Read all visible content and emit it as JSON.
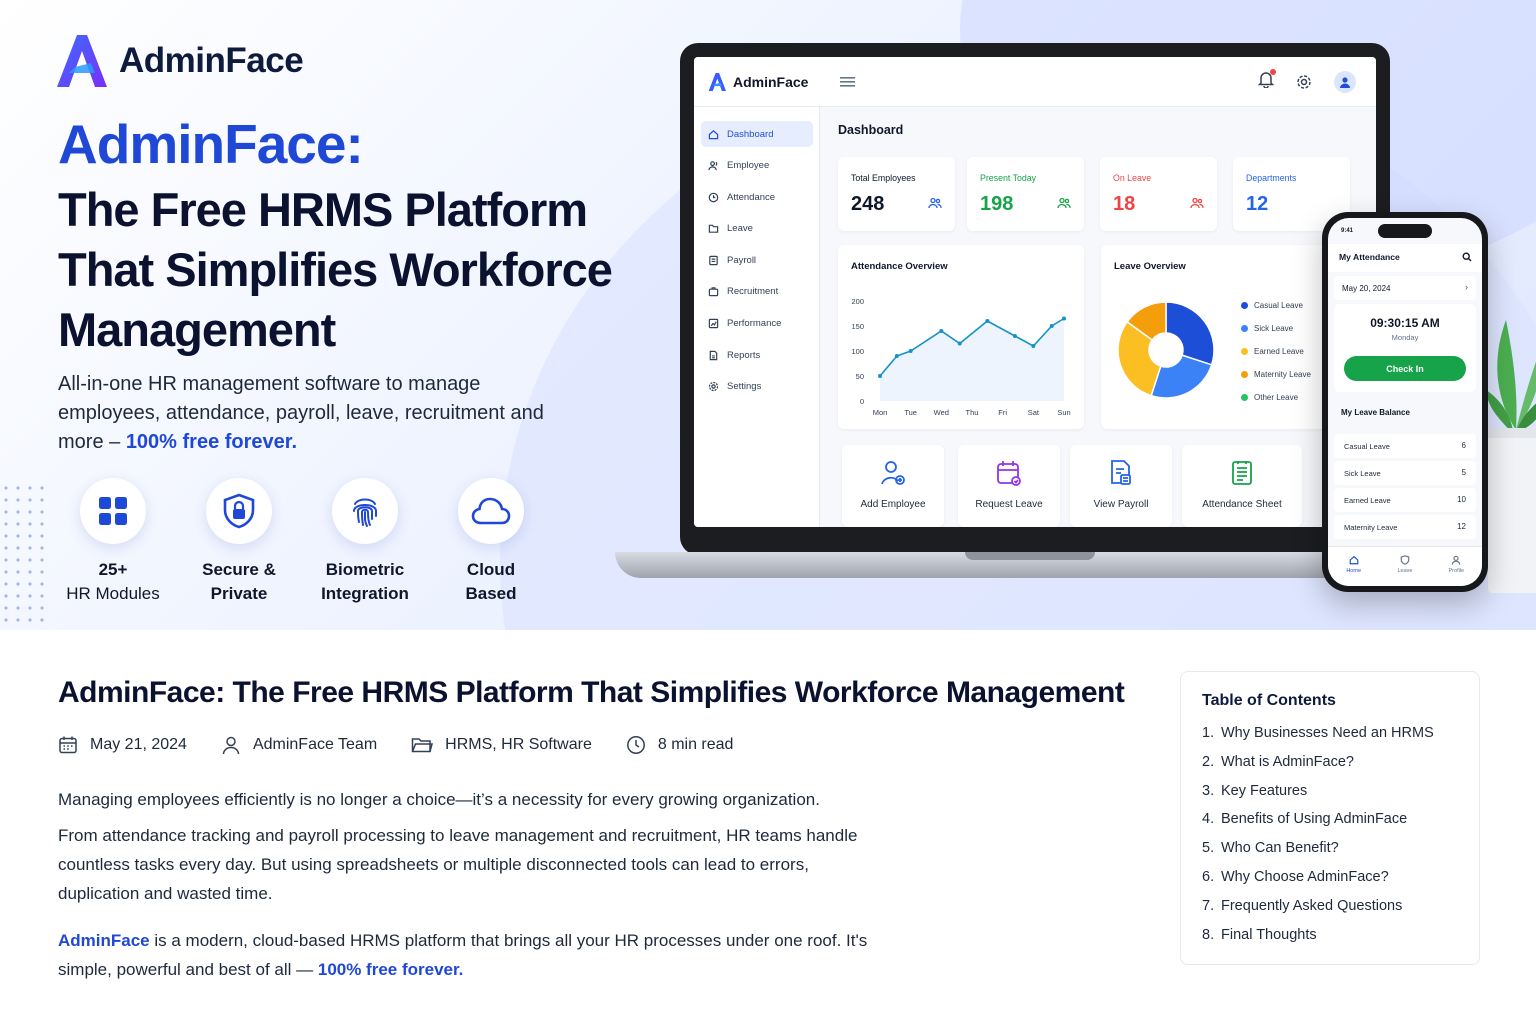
{
  "brand": {
    "name": "AdminFace"
  },
  "hero": {
    "title_accent": "AdminFace:",
    "title": "The Free HRMS Platform That Simplifies Workforce Management",
    "subtitle_prefix": "All-in-one HR management software to manage employees, attendance, payroll, leave, recruitment and more – ",
    "subtitle_highlight": "100% free forever.",
    "features": [
      {
        "icon": "grid-icon",
        "line1": "25+",
        "line2": "HR Modules"
      },
      {
        "icon": "shield-lock-icon",
        "line1": "Secure &",
        "line2": "Private"
      },
      {
        "icon": "fingerprint-icon",
        "line1": "Biometric",
        "line2": "Integration"
      },
      {
        "icon": "cloud-icon",
        "line1": "Cloud",
        "line2": "Based"
      }
    ]
  },
  "dashboard": {
    "app_name": "AdminFace",
    "page_title": "Dashboard",
    "sidebar": [
      {
        "label": "Dashboard",
        "icon": "home-icon",
        "active": true
      },
      {
        "label": "Employee",
        "icon": "users-icon"
      },
      {
        "label": "Attendance",
        "icon": "clock-icon"
      },
      {
        "label": "Leave",
        "icon": "folder-icon"
      },
      {
        "label": "Payroll",
        "icon": "receipt-icon"
      },
      {
        "label": "Recruitment",
        "icon": "briefcase-icon"
      },
      {
        "label": "Performance",
        "icon": "chart-icon"
      },
      {
        "label": "Reports",
        "icon": "document-icon"
      },
      {
        "label": "Settings",
        "icon": "gear-icon"
      }
    ],
    "stats": [
      {
        "label": "Total Employees",
        "value": "248",
        "color": "#0f172a",
        "icon_color": "#2563eb"
      },
      {
        "label": "Present Today",
        "value": "198",
        "color": "#16a34a",
        "icon_color": "#16a34a"
      },
      {
        "label": "On Leave",
        "value": "18",
        "color": "#ef4444",
        "icon_color": "#ef4444"
      },
      {
        "label": "Departments",
        "value": "12",
        "color": "#2563eb",
        "icon_color": "#2563eb"
      }
    ],
    "attendance_overview": {
      "title": "Attendance Overview",
      "chart_data": {
        "type": "line",
        "x": [
          "Mon",
          "Tue",
          "Wed",
          "Thu",
          "Fri",
          "Sat",
          "Sun"
        ],
        "y_ticks": [
          0,
          50,
          100,
          150,
          200
        ],
        "ylim": [
          0,
          200
        ],
        "series": [
          {
            "values": [
              50,
              90,
              100,
              140,
              115,
              160,
              130,
              110,
              150,
              165
            ]
          }
        ],
        "x_positions": [
          0,
          0.55,
          1,
          2,
          2.6,
          3.5,
          4.4,
          5,
          5.6,
          6
        ]
      }
    },
    "leave_overview": {
      "title": "Leave Overview",
      "chart_data": {
        "type": "pie",
        "labels": [
          "Casual Leave",
          "Sick Leave",
          "Earned Leave",
          "Maternity Leave",
          "Other Leave"
        ],
        "values": [
          30,
          25,
          30,
          15,
          0
        ],
        "colors": [
          "#1d4ed8",
          "#3b82f6",
          "#fbbf24",
          "#f59e0b",
          "#22c55e"
        ]
      }
    },
    "quick_actions": [
      {
        "label": "Add Employee",
        "icon": "add-user-icon"
      },
      {
        "label": "Request Leave",
        "icon": "calendar-icon"
      },
      {
        "label": "View Payroll",
        "icon": "payroll-icon"
      },
      {
        "label": "Attendance Sheet",
        "icon": "sheet-icon"
      }
    ]
  },
  "phone": {
    "status_time": "9:41",
    "title": "My Attendance",
    "date": "May 20, 2024",
    "clock": "09:30:15 AM",
    "day": "Monday",
    "check_in": "Check In",
    "balance_title": "My Leave Balance",
    "balances": [
      {
        "name": "Casual Leave",
        "value": "6"
      },
      {
        "name": "Sick Leave",
        "value": "5"
      },
      {
        "name": "Earned Leave",
        "value": "10"
      },
      {
        "name": "Maternity Leave",
        "value": "12"
      }
    ],
    "nav": [
      {
        "label": "Home",
        "active": true
      },
      {
        "label": "Leave"
      },
      {
        "label": "Profile"
      }
    ]
  },
  "article": {
    "title": "AdminFace: The Free HRMS Platform That Simplifies Workforce Management",
    "meta": {
      "date": "May 21, 2024",
      "author": "AdminFace Team",
      "categories": "HRMS, HR Software",
      "read_time": "8 min read"
    },
    "p1": "Managing employees efficiently is no longer a choice—it’s a necessity for every growing organization.",
    "p2": "From attendance tracking and payroll processing to leave management and recruitment, HR teams handle countless tasks every day. But using spreadsheets or multiple disconnected tools can lead to errors, duplication and wasted time.",
    "p3_link": "AdminFace",
    "p3_text": " is a modern, cloud-based HRMS platform that brings all your HR processes under one roof. It's simple, powerful and best of all — ",
    "p3_highlight": "100% free forever."
  },
  "toc": {
    "title": "Table of Contents",
    "items": [
      {
        "num": "1.",
        "label": "Why Businesses Need an HRMS"
      },
      {
        "num": "2.",
        "label": "What is AdminFace?"
      },
      {
        "num": "3.",
        "label": "Key Features"
      },
      {
        "num": "4.",
        "label": "Benefits of Using AdminFace"
      },
      {
        "num": "5.",
        "label": "Who Can Benefit?"
      },
      {
        "num": "6.",
        "label": "Why Choose AdminFace?"
      },
      {
        "num": "7.",
        "label": "Frequently Asked Questions"
      },
      {
        "num": "8.",
        "label": "Final Thoughts"
      }
    ]
  },
  "colors": {
    "accent": "#2048d6",
    "success": "#16a34a",
    "danger": "#ef4444"
  }
}
